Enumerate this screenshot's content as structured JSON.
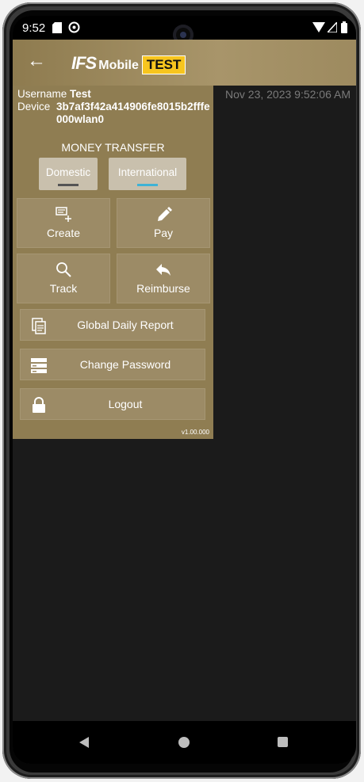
{
  "status_bar": {
    "time": "9:52"
  },
  "app_bar": {
    "back_glyph": "←",
    "logo_ifs": "IFS",
    "logo_mobile": "Mobile",
    "logo_test": "TEST"
  },
  "user_info": {
    "username_label": "Username",
    "username_value": "Test",
    "device_label": "Device",
    "device_value": "3b7af3f42a414906fe8015b2fffe000wlan0"
  },
  "timestamp": "Nov 23, 2023 9:52:06 AM",
  "money_transfer": {
    "title": "MONEY TRANSFER",
    "tabs": [
      {
        "label": "Domestic",
        "indicator_color": "#555555",
        "selected": false
      },
      {
        "label": "International",
        "indicator_color": "#3fb2d6",
        "selected": true
      }
    ]
  },
  "tiles": [
    {
      "label": "Create",
      "icon": "create-icon"
    },
    {
      "label": "Pay",
      "icon": "pay-icon"
    },
    {
      "label": "Track",
      "icon": "search-icon"
    },
    {
      "label": "Reimburse",
      "icon": "reply-icon"
    }
  ],
  "menu": [
    {
      "label": "Global Daily Report",
      "icon": "report-icon"
    },
    {
      "label": "Change Password",
      "icon": "password-icon"
    },
    {
      "label": "Logout",
      "icon": "lock-icon"
    }
  ],
  "version": "v1.00.000",
  "colors": {
    "panel": "#8f7d52",
    "test_badge": "#f7c51e",
    "background": "#1b1b1b"
  }
}
